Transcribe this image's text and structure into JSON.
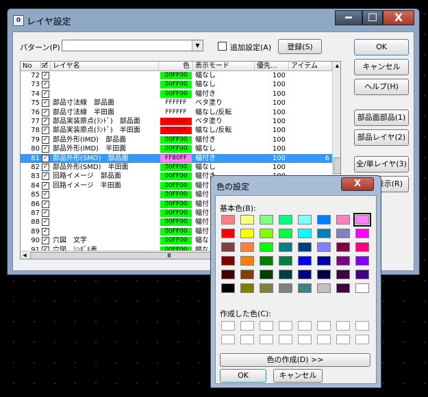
{
  "window": {
    "title": "レイヤ設定",
    "minimize": "━",
    "maximize": "☐",
    "close": "X"
  },
  "pattern": {
    "label": "パターン(P)",
    "value": "",
    "add_setting_label": "追加設定(A)",
    "add_setting_checked": false,
    "register_label": "登録(S)"
  },
  "side_buttons": {
    "ok": "OK",
    "cancel": "キャンセル",
    "help": "ヘルプ(H)",
    "parts_layer_face": "部品面部品(1)",
    "parts_layer": "部品レイヤ(2)",
    "all_single_layer": "全/単レイヤ(3)",
    "display_partial": "表示(R)"
  },
  "table": {
    "columns": [
      "No",
      "🗹",
      "レイヤ名",
      "色",
      "表示モード",
      "優先...",
      "アイテム"
    ],
    "rows": [
      {
        "no": "72",
        "checked": true,
        "name": "",
        "color": "00FF00",
        "color_hex": "#00ff00",
        "mode": "幅なし",
        "priority": "100",
        "items": ""
      },
      {
        "no": "73",
        "checked": true,
        "name": "",
        "color": "00FF00",
        "color_hex": "#00ff00",
        "mode": "幅なし",
        "priority": "100",
        "items": ""
      },
      {
        "no": "74",
        "checked": true,
        "name": "",
        "color": "00FF00",
        "color_hex": "#00ff00",
        "mode": "幅付き",
        "priority": "100",
        "items": ""
      },
      {
        "no": "75",
        "checked": true,
        "name": "部品寸法線　部品面",
        "color": "FFFFFF",
        "color_hex": "#ffffff",
        "mode": "ベタ塗り",
        "priority": "100",
        "items": ""
      },
      {
        "no": "76",
        "checked": true,
        "name": "部品寸法線　半田面",
        "color": "FFFFFF",
        "color_hex": "#ffffff",
        "mode": "幅なし/反転",
        "priority": "100",
        "items": ""
      },
      {
        "no": "77",
        "checked": true,
        "name": "部品実装原点(ﾗﾝﾄﾞ)　部品面",
        "color": "0000FF",
        "color_hex": "#ff0000",
        "mode": "ベタ塗り",
        "priority": "100",
        "items": ""
      },
      {
        "no": "78",
        "checked": true,
        "name": "部品実装原点(ﾗﾝﾄﾞ)　半田面",
        "color": "0000FF",
        "color_hex": "#ff0000",
        "mode": "幅なし/反転",
        "priority": "100",
        "items": ""
      },
      {
        "no": "79",
        "checked": true,
        "name": "部品外形(IMD)　部品面",
        "color": "00FF00",
        "color_hex": "#00ff00",
        "mode": "幅付き",
        "priority": "100",
        "items": ""
      },
      {
        "no": "80",
        "checked": true,
        "name": "部品外形(IMD)　半田面",
        "color": "00FF00",
        "color_hex": "#00ff00",
        "mode": "幅なし",
        "priority": "100",
        "items": ""
      },
      {
        "no": "81",
        "checked": true,
        "name": "部品外形(SMD)　部品面",
        "color": "FF80FF",
        "color_hex": "#ff80ff",
        "mode": "幅付き",
        "priority": "100",
        "items": "6",
        "selected": true
      },
      {
        "no": "82",
        "checked": true,
        "name": "部品外形(SMD)　半田面",
        "color": "00FF00",
        "color_hex": "#00ff00",
        "mode": "幅なし",
        "priority": "100",
        "items": ""
      },
      {
        "no": "83",
        "checked": true,
        "name": "回路イメージ　部品面",
        "color": "00FF00",
        "color_hex": "#00ff00",
        "mode": "幅付き",
        "priority": "100",
        "items": ""
      },
      {
        "no": "84",
        "checked": true,
        "name": "回路イメージ　半田面",
        "color": "00FF00",
        "color_hex": "#00ff00",
        "mode": "幅付",
        "priority": "",
        "items": ""
      },
      {
        "no": "85",
        "checked": true,
        "name": "",
        "color": "00FF00",
        "color_hex": "#00ff00",
        "mode": "幅付",
        "priority": "",
        "items": ""
      },
      {
        "no": "86",
        "checked": true,
        "name": "",
        "color": "00FF00",
        "color_hex": "#00ff00",
        "mode": "幅付",
        "priority": "",
        "items": ""
      },
      {
        "no": "87",
        "checked": true,
        "name": "",
        "color": "00FF00",
        "color_hex": "#00ff00",
        "mode": "幅付",
        "priority": "",
        "items": ""
      },
      {
        "no": "88",
        "checked": true,
        "name": "",
        "color": "00FF00",
        "color_hex": "#00ff00",
        "mode": "幅付",
        "priority": "",
        "items": ""
      },
      {
        "no": "89",
        "checked": true,
        "name": "",
        "color": "00FF00",
        "color_hex": "#00ff00",
        "mode": "幅付",
        "priority": "",
        "items": ""
      },
      {
        "no": "90",
        "checked": true,
        "name": "穴図　文字",
        "color": "00FF00",
        "color_hex": "#00ff00",
        "mode": "幅な",
        "priority": "",
        "items": ""
      },
      {
        "no": "91",
        "checked": true,
        "name": "穴図　ｼﾝﾎﾞﾙ表",
        "color": "00FF00",
        "color_hex": "#00ff00",
        "mode": "幅な",
        "priority": "",
        "items": ""
      }
    ],
    "scroll_thumb": "Ⅲ"
  },
  "color_dialog": {
    "title": "色の設定",
    "close": "X",
    "basic_colors_label": "基本色(B):",
    "basic_colors": [
      [
        "#ff8080",
        "#ffff80",
        "#80ff80",
        "#00ff80",
        "#80ffff",
        "#0080ff",
        "#ff80c0",
        "#ff80ff"
      ],
      [
        "#ff0000",
        "#ffff00",
        "#80ff00",
        "#00ff40",
        "#00ffff",
        "#0080c0",
        "#8080c0",
        "#ff00ff"
      ],
      [
        "#804040",
        "#ff8040",
        "#00ff00",
        "#008080",
        "#004080",
        "#8080ff",
        "#800040",
        "#ff0080"
      ],
      [
        "#800000",
        "#ff8000",
        "#008000",
        "#008040",
        "#0000ff",
        "#0000a0",
        "#800080",
        "#8000ff"
      ],
      [
        "#400000",
        "#804000",
        "#004000",
        "#004040",
        "#000080",
        "#000040",
        "#400040",
        "#400080"
      ],
      [
        "#000000",
        "#808000",
        "#808040",
        "#808080",
        "#408080",
        "#c0c0c0",
        "#400040",
        "#ffffff"
      ]
    ],
    "selected_basic": "#ff80ff",
    "custom_colors_label": "作成した色(C):",
    "define_custom_label": "色の作成(D) >>",
    "ok": "OK",
    "cancel": "キャンセル"
  }
}
